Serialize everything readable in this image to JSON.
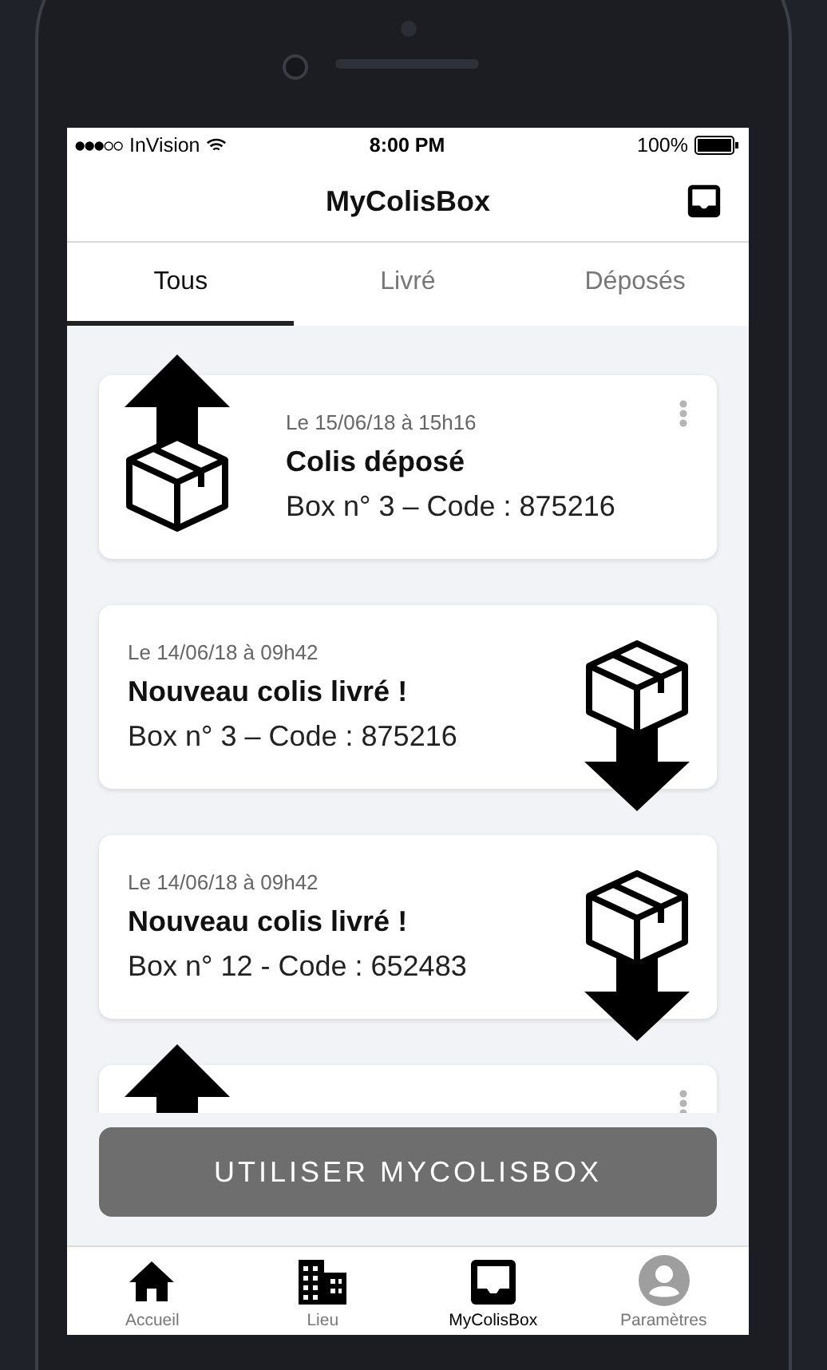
{
  "status_bar": {
    "carrier": "InVision",
    "time": "8:00 PM",
    "battery": "100%"
  },
  "header": {
    "title": "MyColisBox"
  },
  "tabs": [
    {
      "label": "Tous",
      "selected": true
    },
    {
      "label": "Livré",
      "selected": false
    },
    {
      "label": "Déposés",
      "selected": false
    }
  ],
  "cards": [
    {
      "kind": "deposit",
      "date": "Le 15/06/18 à 15h16",
      "title": "Colis déposé",
      "detail": "Box n° 3 – Code : 875216"
    },
    {
      "kind": "delivered",
      "date": "Le 14/06/18 à 09h42",
      "title": "Nouveau colis livré !",
      "detail": "Box n° 3 – Code : 875216"
    },
    {
      "kind": "delivered",
      "date": "Le 14/06/18 à 09h42",
      "title": "Nouveau colis livré !",
      "detail": "Box n° 12 - Code : 652483"
    },
    {
      "kind": "deposit"
    }
  ],
  "action_button": "UTILISER MYCOLISBOX",
  "bottom_nav": [
    {
      "label": "Accueil",
      "selected": false
    },
    {
      "label": "Lieu",
      "selected": false
    },
    {
      "label": "MyColisBox",
      "selected": true
    },
    {
      "label": "Paramètres",
      "selected": false
    }
  ]
}
